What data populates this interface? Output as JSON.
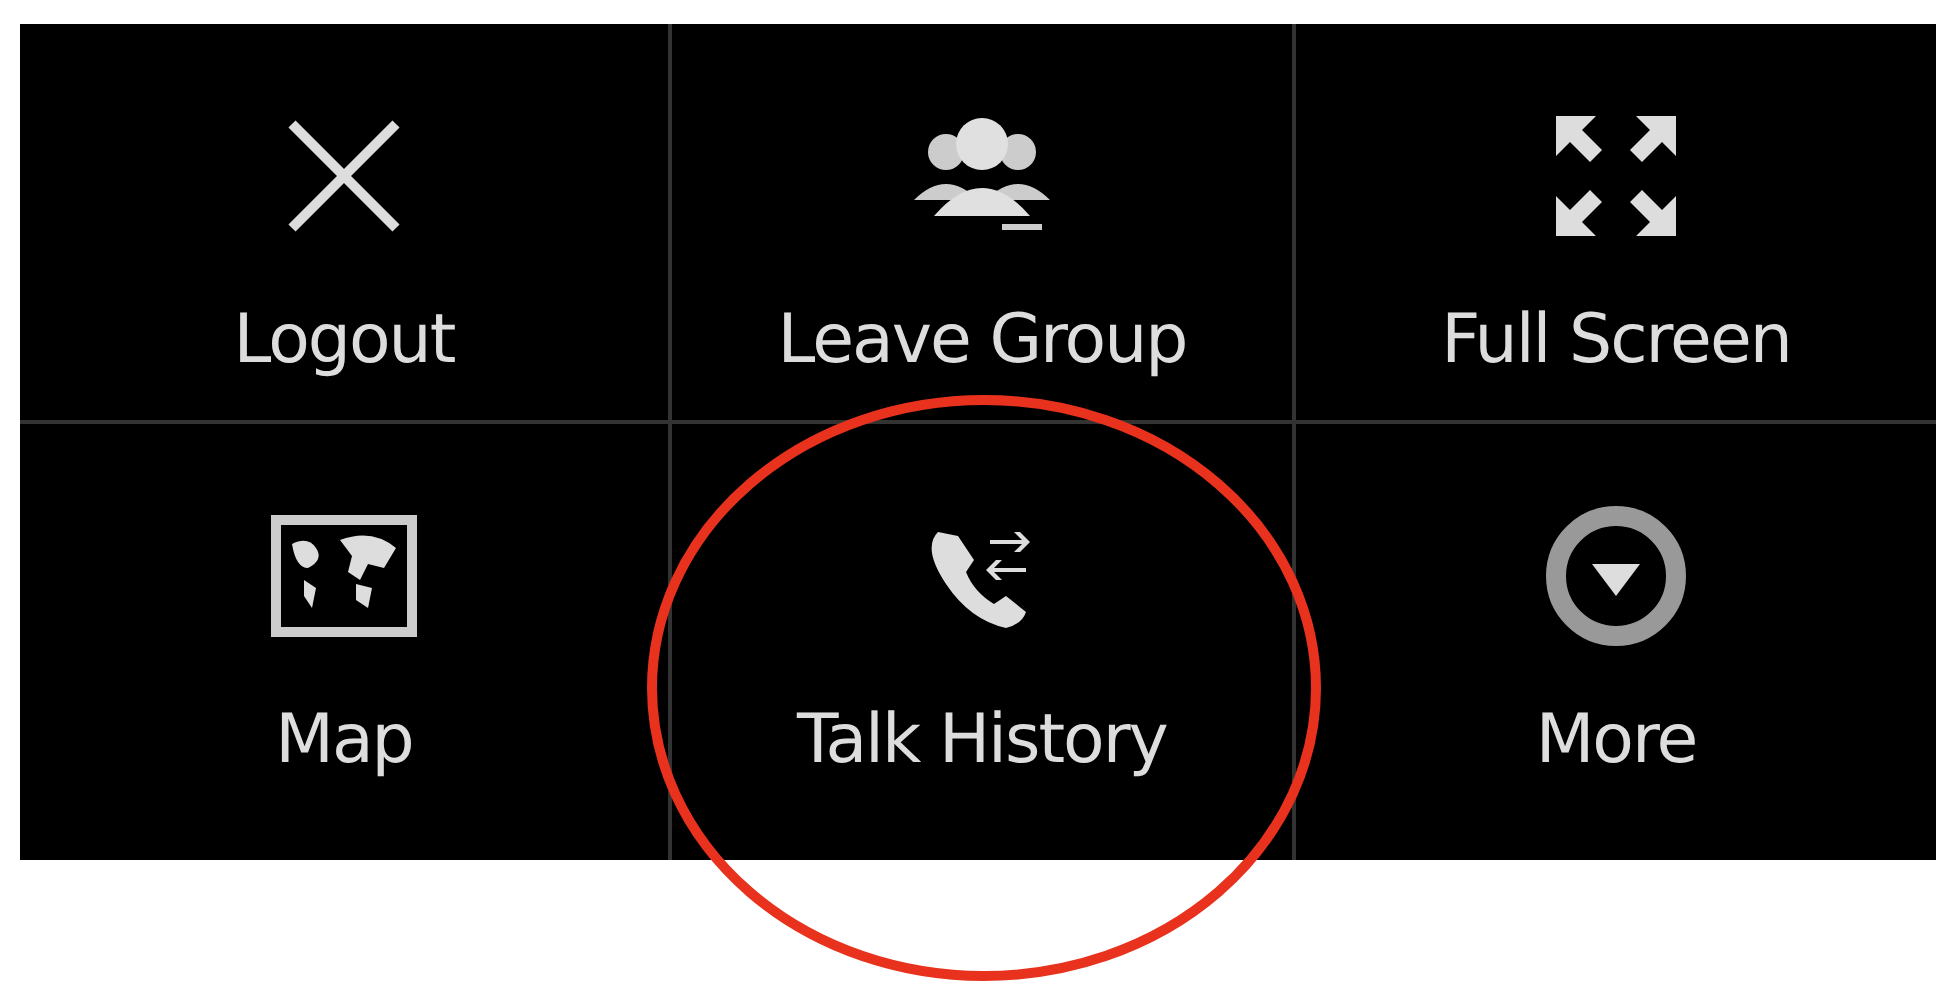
{
  "menu": {
    "items": [
      {
        "label": "Logout",
        "kind": "close",
        "highlighted": false
      },
      {
        "label": "Leave Group",
        "kind": "group",
        "highlighted": false
      },
      {
        "label": "Full Screen",
        "kind": "fullscreen",
        "highlighted": false
      },
      {
        "label": "Map",
        "kind": "map",
        "highlighted": false
      },
      {
        "label": "Talk History",
        "kind": "history",
        "highlighted": true
      },
      {
        "label": "More",
        "kind": "more",
        "highlighted": false
      }
    ]
  }
}
